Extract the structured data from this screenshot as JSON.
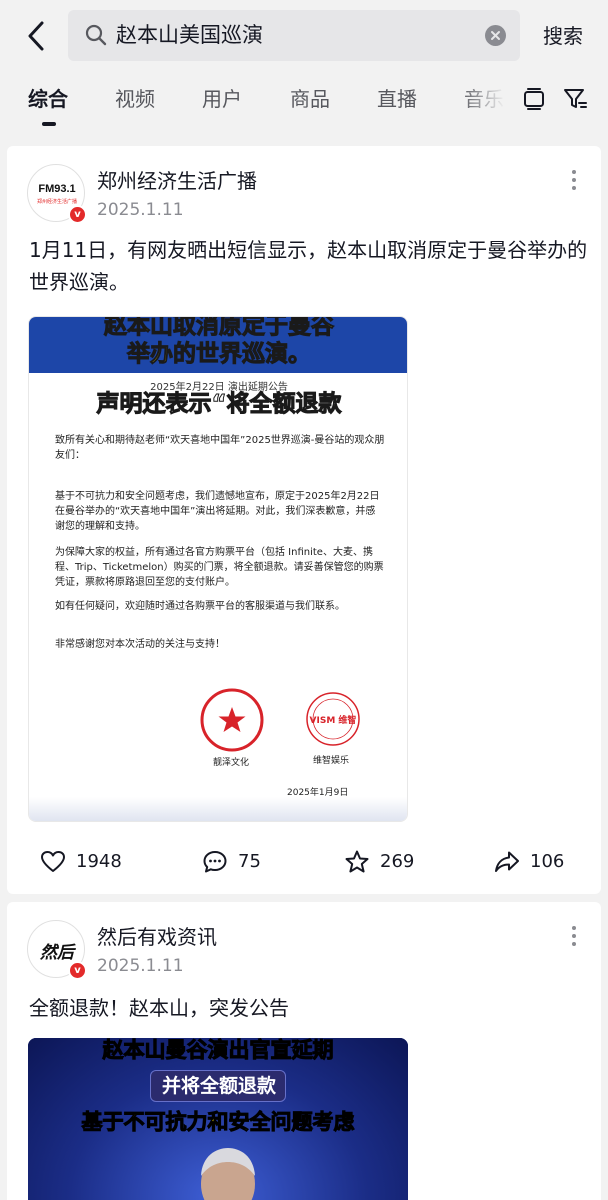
{
  "search": {
    "query": "赵本山美国巡演",
    "button_label": "搜索"
  },
  "tabs": [
    {
      "label": "综合",
      "active": true
    },
    {
      "label": "视频"
    },
    {
      "label": "用户"
    },
    {
      "label": "商品"
    },
    {
      "label": "直播"
    },
    {
      "label": "音乐"
    }
  ],
  "colors": {
    "background": "#f2f2f2",
    "card": "#ffffff",
    "text_primary": "#161823",
    "text_secondary": "#8a8b91",
    "verified_badge": "#e32a2a",
    "stamp_red": "#d8232a"
  },
  "posts": [
    {
      "author": "郑州经济生活广播",
      "avatar_text": "FM93.1",
      "avatar_subtext": "郑州经济生活广播",
      "date": "2025.1.11",
      "text": "1月11日，有网友晒出短信显示，赵本山取消原定于曼谷举办的世界巡演。",
      "media": {
        "caption_line1": "赵本山取消原定于曼谷",
        "caption_line2": "举办的世界巡演。",
        "notice_title": "2025年2月22日 演出延期公告",
        "banner": "声明还表示“将全额退款",
        "greeting": "致所有关心和期待赵老师“欢天喜地中国年”2025世界巡演-曼谷站的观众朋友们：",
        "para1": "基于不可抗力和安全问题考虑，我们遗憾地宣布，原定于2025年2月22日在曼谷举办的“欢天喜地中国年”演出将延期。对此，我们深表歉意，并感谢您的理解和支持。",
        "para2": "为保障大家的权益，所有通过各官方购票平台（包括 Infinite、大麦、携程、Trip、Ticketmelon）购买的门票，将全额退款。请妥善保管您的购票凭证，票款将原路退回至您的支付账户。",
        "para3": "如有任何疑问，欢迎随时通过各购票平台的客服渠道与我们联系。",
        "para4": "非常感谢您对本次活动的关注与支持！",
        "org1": "靓泽文化",
        "seal1_text": "南京靓泽文化传播有限公司",
        "org2": "维智娱乐",
        "seal2_text": "VISM 维智",
        "sign_date": "2025年1月9日"
      },
      "likes": "1948",
      "comments": "75",
      "favorites": "269",
      "shares": "106"
    },
    {
      "author": "然后有戏资讯",
      "avatar_text": "然后",
      "date": "2025.1.11",
      "text": "全额退款！赵本山，突发公告",
      "media": {
        "title1": "赵本山曼谷演出官宣延期",
        "title2": "并将全额退款",
        "title3": "基于不可抗力和安全问题考虑"
      }
    }
  ]
}
